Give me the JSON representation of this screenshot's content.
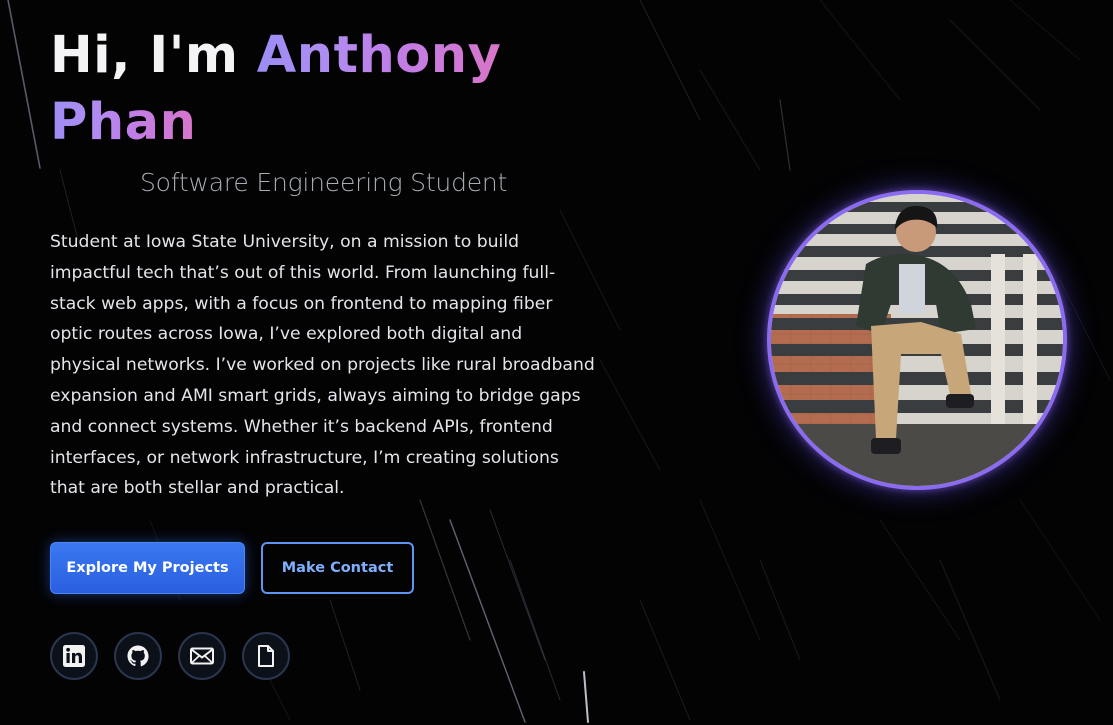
{
  "hero": {
    "greeting": "Hi, I'm",
    "name_first": "Anthony",
    "name_last": "Phan",
    "subtitle": "Software Engineering Student",
    "bio": "Student at Iowa State University, on a mission to build impactful tech that’s out of this world. From launching full-stack web apps, with a focus on frontend to mapping fiber optic routes across Iowa, I’ve explored both digital and physical networks. I’ve worked on projects like rural broadband expansion and AMI smart grids, always aiming to bridge gaps and connect systems. Whether it’s backend APIs, frontend interfaces, or network infrastructure, I’m creating solutions that are both stellar and practical."
  },
  "buttons": {
    "primary_label": "Explore My Projects",
    "secondary_label": "Make Contact"
  },
  "socials": [
    {
      "icon": "linkedin-icon"
    },
    {
      "icon": "github-icon"
    },
    {
      "icon": "mail-icon"
    },
    {
      "icon": "file-icon"
    }
  ],
  "colors": {
    "background": "#030304",
    "name_gradient_start": "#9c8df5",
    "name_gradient_end": "#d875c9",
    "primary_button": "#2f68e8",
    "secondary_button_border": "#5d95f2",
    "avatar_ring": "#8b6cf0"
  }
}
